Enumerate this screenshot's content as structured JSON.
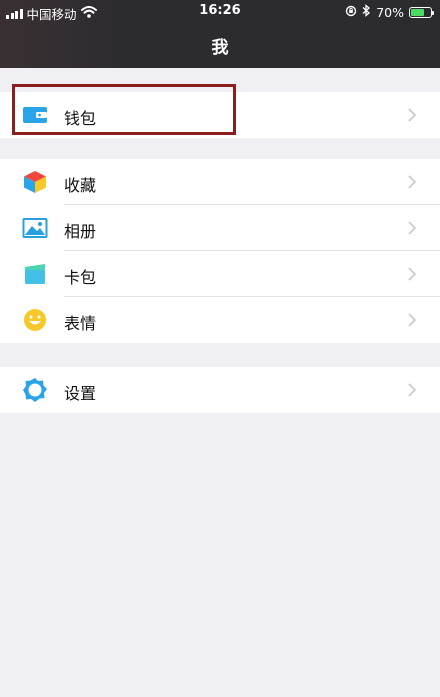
{
  "status_bar": {
    "carrier": "中国移动",
    "time": "16:26",
    "battery_percent": "70%",
    "battery_level": 0.7,
    "icons": [
      "signal-bars-icon",
      "wifi-icon",
      "lock-rotation-icon",
      "bluetooth-icon",
      "battery-icon"
    ]
  },
  "nav": {
    "title": "我"
  },
  "groups": [
    {
      "items": [
        {
          "label": "钱包",
          "icon": "wallet-icon",
          "highlighted": true
        }
      ]
    },
    {
      "items": [
        {
          "label": "收藏",
          "icon": "cube-icon"
        },
        {
          "label": "相册",
          "icon": "photo-icon"
        },
        {
          "label": "卡包",
          "icon": "card-icon"
        },
        {
          "label": "表情",
          "icon": "smiley-icon"
        }
      ]
    },
    {
      "items": [
        {
          "label": "设置",
          "icon": "gear-icon"
        }
      ]
    }
  ],
  "colors": {
    "nav_bg": "#2b2b30",
    "page_bg": "#efeff4",
    "highlight_border": "#8b1f1f",
    "battery_fill": "#4cd964",
    "wallet": "#2aa4e8",
    "photo": "#26a0e0",
    "card": "#43c0e8",
    "smiley": "#f6c928",
    "gear": "#2aa4e8"
  }
}
